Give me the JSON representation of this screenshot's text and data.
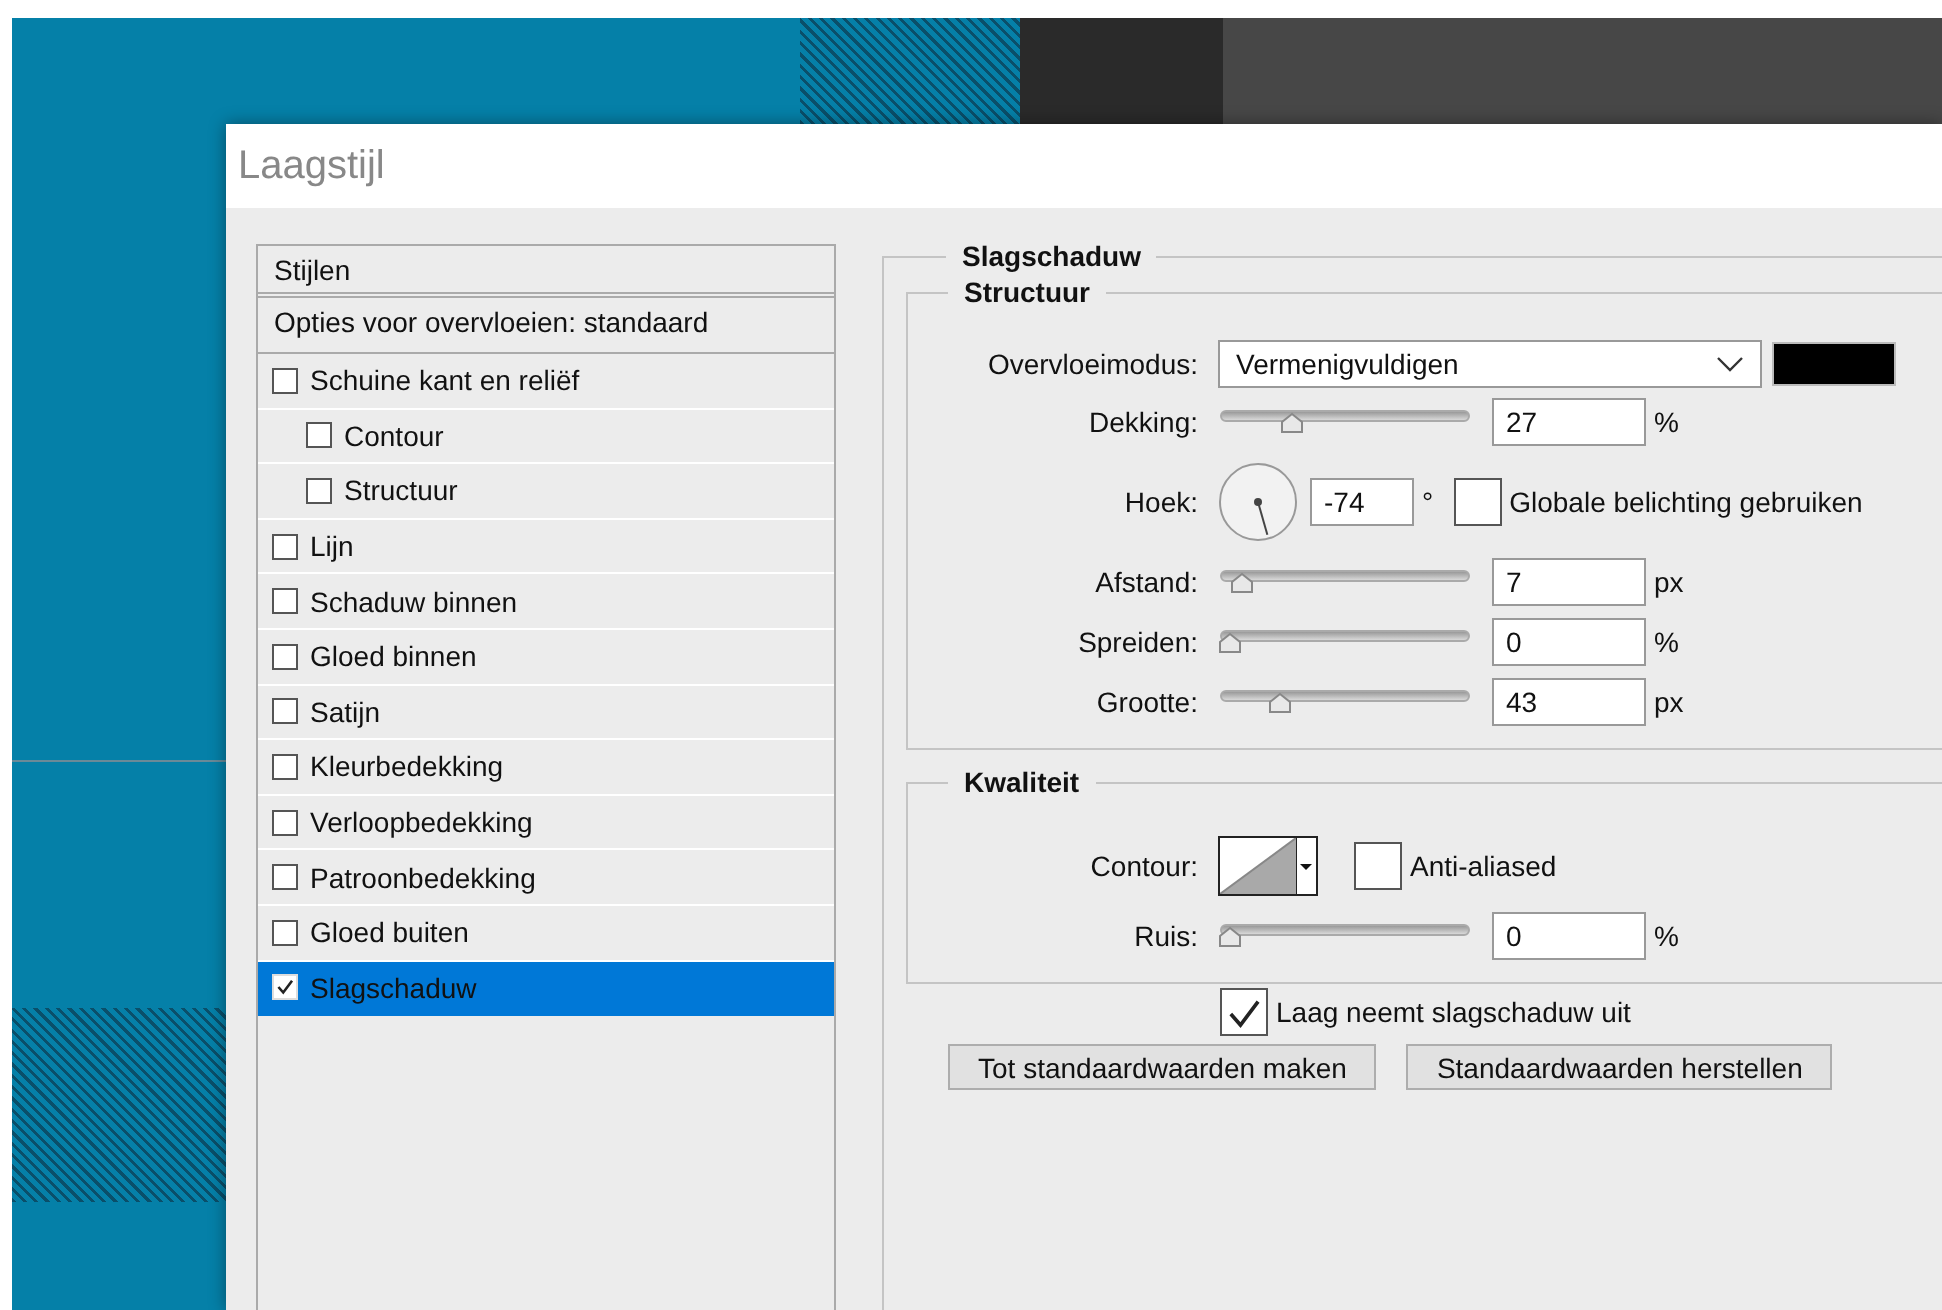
{
  "window": {
    "title": "Laagstijl"
  },
  "styles_panel": {
    "header": "Stijlen",
    "blending_options": "Opties voor overvloeien: standaard",
    "items": [
      {
        "label": "Schuine kant en reliëf",
        "checked": false,
        "selected": false,
        "children": [
          {
            "label": "Contour",
            "checked": false,
            "selected": false
          },
          {
            "label": "Structuur",
            "checked": false,
            "selected": false
          }
        ]
      },
      {
        "label": "Lijn",
        "checked": false,
        "selected": false
      },
      {
        "label": "Schaduw binnen",
        "checked": false,
        "selected": false
      },
      {
        "label": "Gloed binnen",
        "checked": false,
        "selected": false
      },
      {
        "label": "Satijn",
        "checked": false,
        "selected": false
      },
      {
        "label": "Kleurbedekking",
        "checked": false,
        "selected": false
      },
      {
        "label": "Verloopbedekking",
        "checked": false,
        "selected": false
      },
      {
        "label": "Patroonbedekking",
        "checked": false,
        "selected": false
      },
      {
        "label": "Gloed buiten",
        "checked": false,
        "selected": false
      },
      {
        "label": "Slagschaduw",
        "checked": true,
        "selected": true
      }
    ]
  },
  "effect": {
    "title": "Slagschaduw",
    "structure": {
      "title": "Structuur",
      "rows": [
        {
          "kind": "blend",
          "label": "Overvloeimodus:",
          "value": "Vermenigvuldigen",
          "color": "#000000"
        },
        {
          "kind": "slider",
          "label": "Dekking:",
          "level": 0.27,
          "value": "27",
          "unit": "%"
        },
        {
          "kind": "angle",
          "label": "Hoek:",
          "value": "-74",
          "unit": "°",
          "global_light": {
            "label": "Globale belichting gebruiken",
            "checked": false
          }
        },
        {
          "kind": "slider",
          "label": "Afstand:",
          "level": 0.05,
          "value": "7",
          "unit": "px"
        },
        {
          "kind": "slider",
          "label": "Spreiden:",
          "level": 0,
          "value": "0",
          "unit": "%"
        },
        {
          "kind": "slider",
          "label": "Grootte:",
          "level": 0.22,
          "value": "43",
          "unit": "px"
        }
      ]
    },
    "quality": {
      "title": "Kwaliteit",
      "rows": [
        {
          "kind": "contour",
          "label": "Contour:",
          "anti_aliased": {
            "label": "Anti-aliased",
            "checked": false
          }
        },
        {
          "kind": "slider",
          "label": "Ruis:",
          "level": 0,
          "value": "0",
          "unit": "%"
        }
      ]
    },
    "knockout": {
      "label": "Laag neemt slagschaduw uit",
      "checked": true
    },
    "buttons": [
      "Tot standaardwaarden maken",
      "Standaardwaarden herstellen"
    ]
  }
}
